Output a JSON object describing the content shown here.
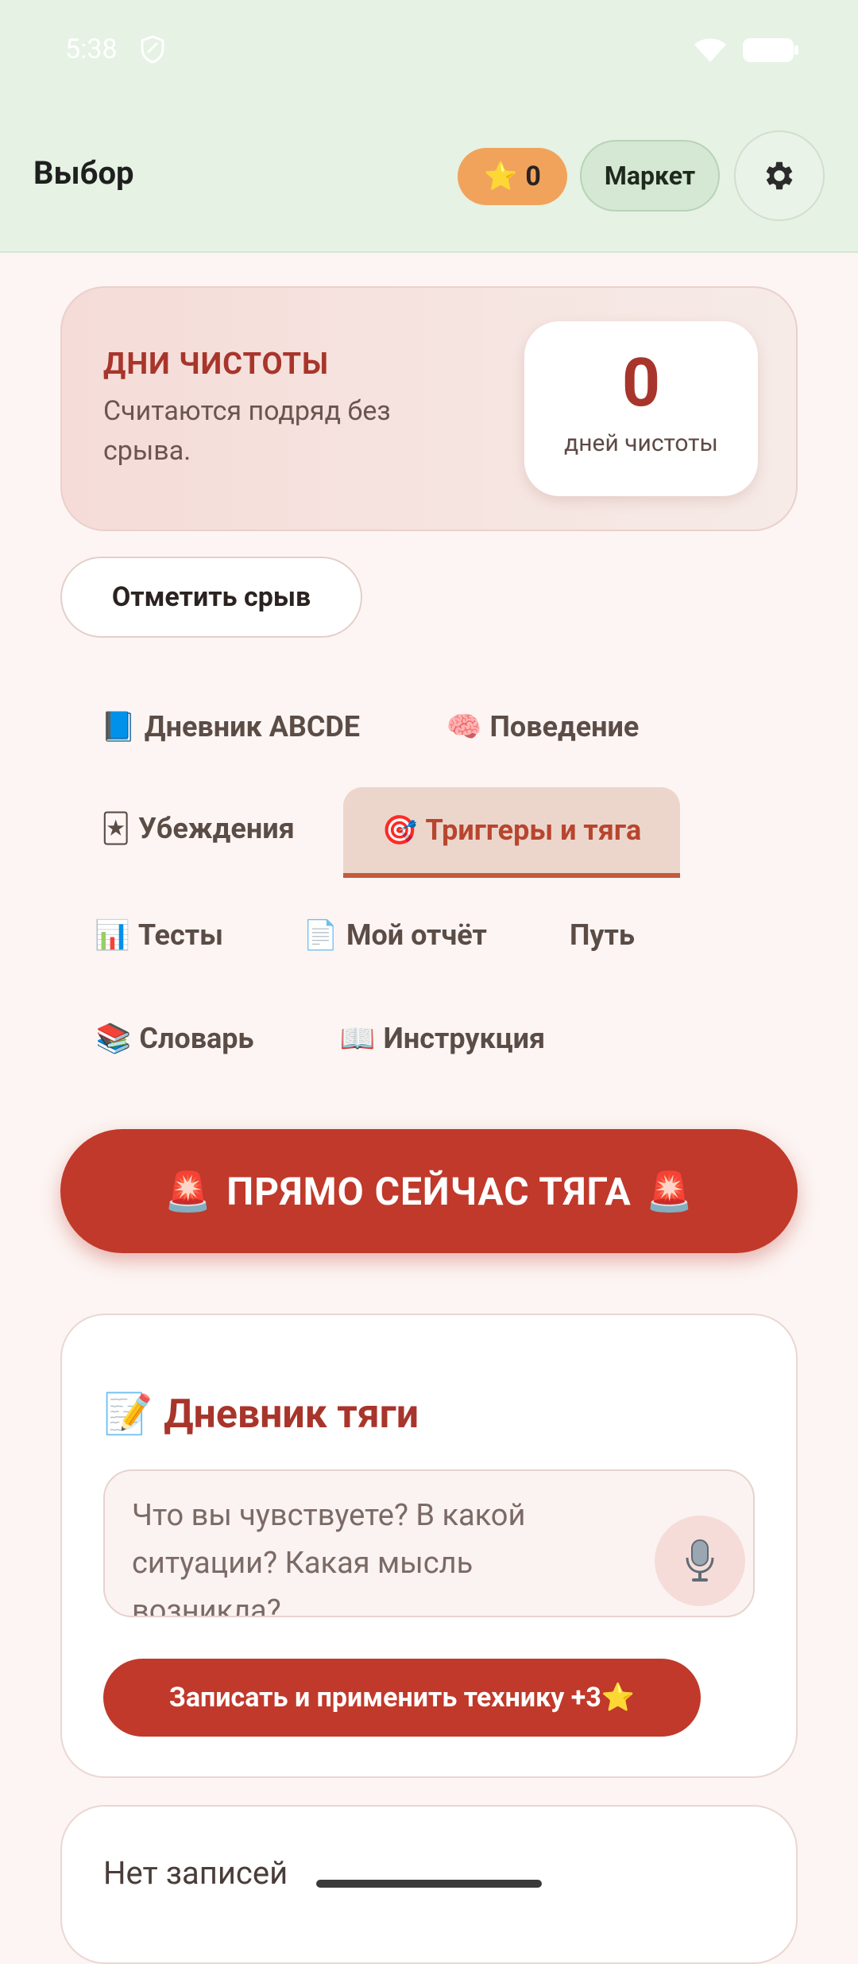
{
  "status": {
    "time": "5:38"
  },
  "header": {
    "title": "Выбор",
    "stars_icon": "⭐",
    "stars_count": "0",
    "market_label": "Маркет"
  },
  "clean": {
    "title": "ДНИ ЧИСТОТЫ",
    "subtitle": "Считаются подряд без срыва.",
    "count": "0",
    "count_label": "дней чистоты"
  },
  "relapse_button": "Отметить срыв",
  "tabs": [
    {
      "icon": "📘",
      "label": "Дневник ABCDE"
    },
    {
      "icon": "🧠",
      "label": "Поведение"
    },
    {
      "icon": "🃏",
      "label": "Убеждения"
    },
    {
      "icon": "🎯",
      "label": "Триггеры и тяга",
      "active": true
    },
    {
      "icon": "📊",
      "label": "Тесты"
    },
    {
      "icon": "📄",
      "label": "Мой отчёт"
    },
    {
      "icon": "",
      "label": "Путь"
    },
    {
      "icon": "📚",
      "label": "Словарь"
    },
    {
      "icon": "📖",
      "label": "Инструкция"
    }
  ],
  "craving_button": {
    "icon": "🚨",
    "label": "ПРЯМО СЕЙЧАС ТЯГА"
  },
  "diary": {
    "icon": "📝",
    "title": "Дневник тяги",
    "placeholder": "Что вы чувствуете? В какой ситуации? Какая мысль возникла?",
    "submit_label": "Записать и применить технику +3⭐"
  },
  "entries": {
    "empty_text": "Нет записей"
  },
  "colors": {
    "accent": "#c0392b",
    "header_bg": "#e5f2e4",
    "stars_pill": "#f1a35c"
  }
}
